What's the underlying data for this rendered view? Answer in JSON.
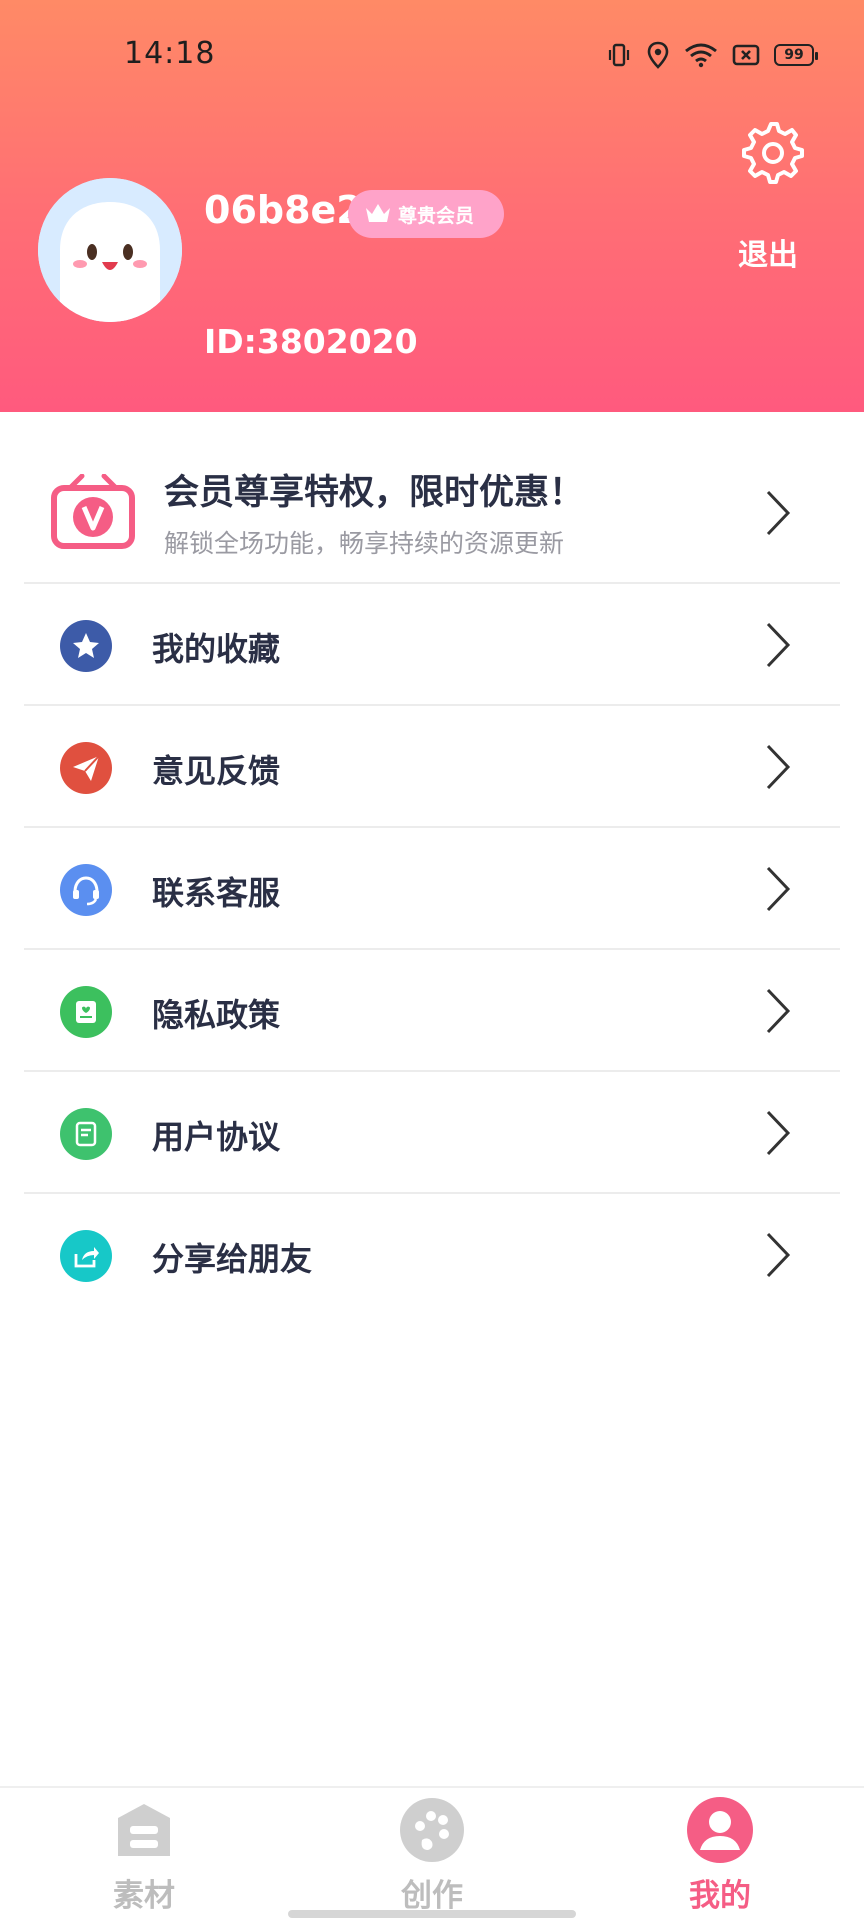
{
  "status_bar": {
    "time": "14:18",
    "battery": "99"
  },
  "profile": {
    "username": "06b8e2",
    "vip_badge": "尊贵会员",
    "user_id": "ID:3802020",
    "logout": "退出"
  },
  "promo": {
    "title": "会员尊享特权，限时优惠！",
    "subtitle": "解锁全场功能，畅享持续的资源更新"
  },
  "menu": [
    {
      "label": "我的收藏",
      "icon": "star-icon",
      "color": "#3d5ba8"
    },
    {
      "label": "意见反馈",
      "icon": "paper-plane-icon",
      "color": "#e0503f"
    },
    {
      "label": "联系客服",
      "icon": "headset-icon",
      "color": "#5b8ff0"
    },
    {
      "label": "隐私政策",
      "icon": "document-icon",
      "color": "#3cc05e"
    },
    {
      "label": "用户协议",
      "icon": "agreement-icon",
      "color": "#3ec26e"
    },
    {
      "label": "分享给朋友",
      "icon": "share-icon",
      "color": "#17c8c8"
    }
  ],
  "tabs": [
    {
      "label": "素材",
      "icon": "material-icon",
      "active": false
    },
    {
      "label": "创作",
      "icon": "palette-icon",
      "active": false
    },
    {
      "label": "我的",
      "icon": "user-icon",
      "active": true
    }
  ],
  "colors": {
    "accent": "#f55d85",
    "header_top": "#ff8a66",
    "header_bottom": "#ff5a7e"
  }
}
